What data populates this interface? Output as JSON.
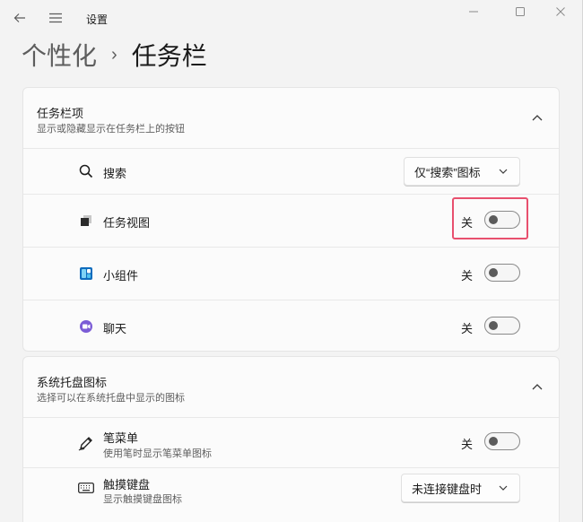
{
  "app": {
    "title": "设置"
  },
  "breadcrumb": {
    "parent": "个性化",
    "separator": "›",
    "current": "任务栏"
  },
  "taskbar_items": {
    "title": "任务栏项",
    "subtitle": "显示或隐藏显示在任务栏上的按钮",
    "rows": [
      {
        "label": "搜索",
        "icon": "search-icon",
        "control": "dropdown",
        "value": "仅“搜索”图标"
      },
      {
        "label": "任务视图",
        "icon": "task-view-icon",
        "control": "toggle",
        "state": "关",
        "on": false
      },
      {
        "label": "小组件",
        "icon": "widgets-icon",
        "control": "toggle",
        "state": "关",
        "on": false
      },
      {
        "label": "聊天",
        "icon": "chat-icon",
        "control": "toggle",
        "state": "关",
        "on": false
      }
    ]
  },
  "system_tray": {
    "title": "系统托盘图标",
    "subtitle": "选择可以在系统托盘中显示的图标",
    "rows": [
      {
        "label": "笔菜单",
        "sub": "使用笔时显示笔菜单图标",
        "icon": "pen-icon",
        "control": "toggle",
        "state": "关",
        "on": false
      },
      {
        "label": "触摸键盘",
        "sub": "显示触摸键盘图标",
        "icon": "keyboard-icon",
        "control": "dropdown",
        "value": "未连接键盘时"
      }
    ]
  },
  "colors": {
    "highlight": "#e8506e",
    "background": "#f3f3f3",
    "card": "#fbfbfb"
  }
}
